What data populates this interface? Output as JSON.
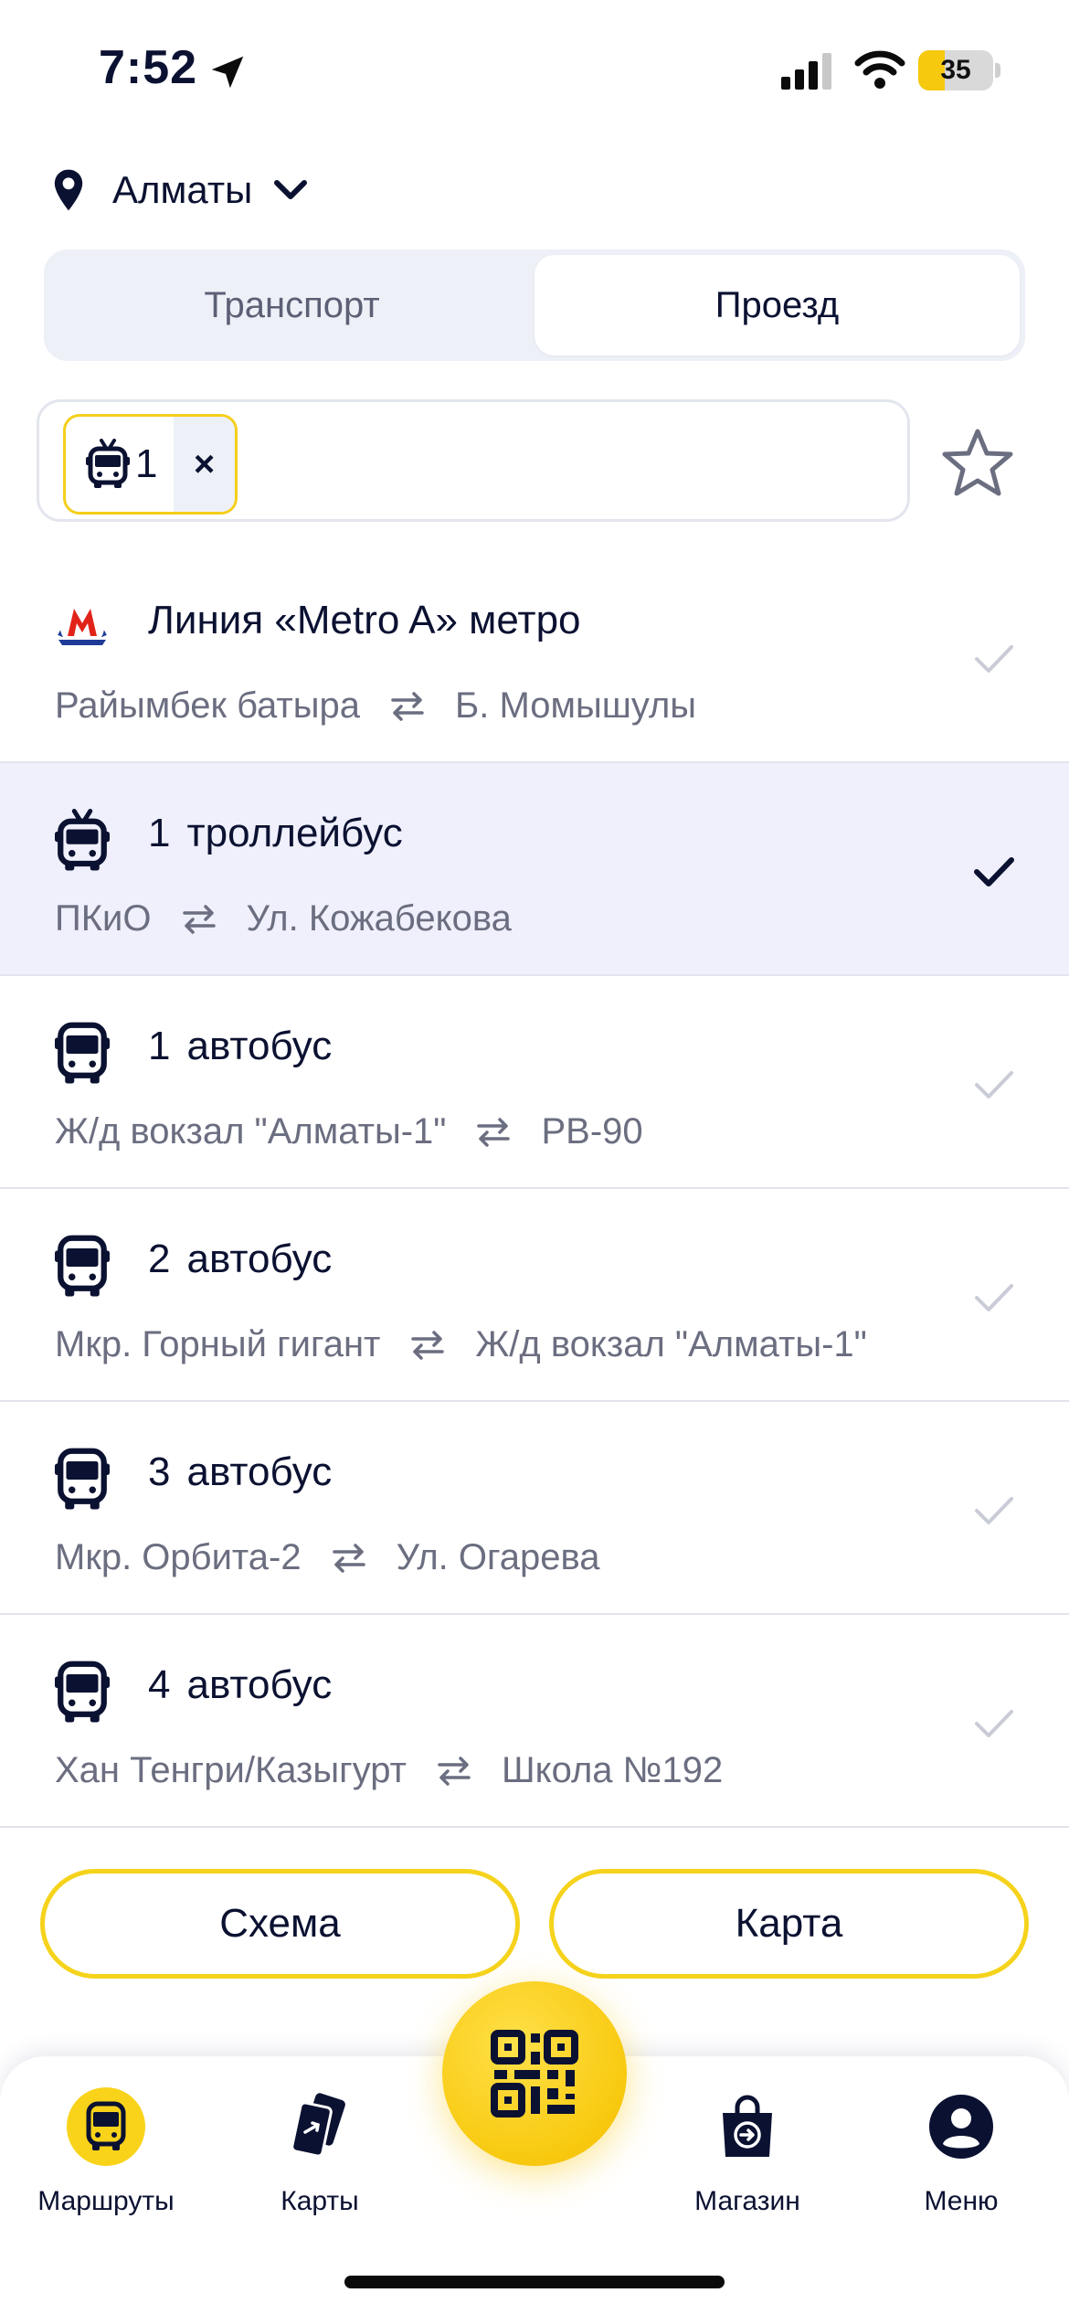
{
  "status_bar": {
    "time": "7:52",
    "battery": "35",
    "battery_level": 0.35
  },
  "city": {
    "name": "Алматы"
  },
  "segments": [
    {
      "label": "Транспорт",
      "active": false
    },
    {
      "label": "Проезд",
      "active": true
    }
  ],
  "search": {
    "chip_number": "1",
    "chip_remove": "×"
  },
  "routes": [
    {
      "icon": "metro-logo-icon",
      "number": "",
      "title": "Линия «Metro A»  метро",
      "from": "Райымбек батыра",
      "to": "Б. Момышулы",
      "selected": false
    },
    {
      "icon": "trolleybus-icon",
      "number": "1",
      "title": "троллейбус",
      "from": "ПКиО",
      "to": "Ул. Кожабекова",
      "selected": true
    },
    {
      "icon": "bus-icon",
      "number": "1",
      "title": "автобус",
      "from": "Ж/д вокзал \"Алматы-1\"",
      "to": "РВ-90",
      "selected": false
    },
    {
      "icon": "bus-icon",
      "number": "2",
      "title": "автобус",
      "from": "Мкр. Горный гигант",
      "to": "Ж/д вокзал \"Алматы-1\"",
      "selected": false
    },
    {
      "icon": "bus-icon",
      "number": "3",
      "title": "автобус",
      "from": "Мкр. Орбита-2",
      "to": "Ул. Огарева",
      "selected": false
    },
    {
      "icon": "bus-icon",
      "number": "4",
      "title": "автобус",
      "from": "Хан Тенгри/Казыгурт",
      "to": "Школа №192",
      "selected": false
    }
  ],
  "buttons": {
    "scheme": "Схема",
    "map": "Карта"
  },
  "tabs": [
    {
      "label": "Маршруты",
      "icon": "bus-icon",
      "active": true
    },
    {
      "label": "Карты",
      "icon": "cards-icon",
      "active": false
    },
    {
      "label": "Магазин",
      "icon": "shop-bag-icon",
      "active": false
    },
    {
      "label": "Меню",
      "icon": "profile-icon",
      "active": false
    }
  ],
  "colors": {
    "accent": "#f8cd16",
    "text": "#0b1131",
    "muted": "#6b6e80",
    "selected_bg": "#eff0fb"
  }
}
